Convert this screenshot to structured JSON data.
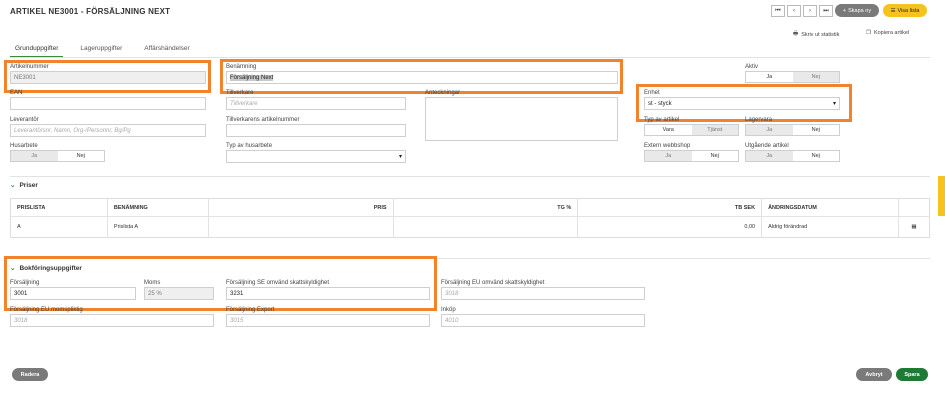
{
  "header": {
    "title": "ARTIKEL NE3001 - FÖRSÄLJNING NEXT",
    "nav": {
      "first": "⏮",
      "prev": "‹",
      "next": "›",
      "last": "⏭"
    },
    "create_new": "Skapa ny",
    "show_list": "Visa lista"
  },
  "actions": {
    "print_stats": "Skriv ut statistik",
    "copy_article": "Kopiera artikel"
  },
  "tabs": [
    "Grunduppgifter",
    "Lageruppgifter",
    "Affärshändelser"
  ],
  "form": {
    "artikelnummer": {
      "label": "Artikelnummer",
      "value": "NE3001"
    },
    "ean": {
      "label": "EAN",
      "value": ""
    },
    "leverantor": {
      "label": "Leverantör",
      "placeholder": "Leverantörsnr, Namn, Org-/Personnr, Bg/Pg"
    },
    "husarbete": {
      "label": "Husarbete",
      "yes": "Ja",
      "no": "Nej"
    },
    "benamning": {
      "label": "Benämning",
      "value": "Försäljning Next"
    },
    "tillverkare": {
      "label": "Tillverkare",
      "placeholder": "Tillverkare"
    },
    "tillverkarens_artikelnummer": {
      "label": "Tillverkarens artikelnummer",
      "value": ""
    },
    "typ_av_husarbete": {
      "label": "Typ av husarbete",
      "value": ""
    },
    "anteckningar": {
      "label": "Anteckningar",
      "value": ""
    },
    "aktiv": {
      "label": "Aktiv",
      "yes": "Ja",
      "no": "Nej"
    },
    "enhet": {
      "label": "Enhet",
      "value": "st - styck"
    },
    "typ_av_artikel": {
      "label": "Typ av artikel",
      "goods": "Vara",
      "service": "Tjänst"
    },
    "lagervara": {
      "label": "Lagervara",
      "yes": "Ja",
      "no": "Nej"
    },
    "extern_webbshop": {
      "label": "Extern webbshop",
      "yes": "Ja",
      "no": "Nej"
    },
    "utgaende_artikel": {
      "label": "Utgående artikel",
      "yes": "Ja",
      "no": "Nej"
    }
  },
  "priser": {
    "title": "Priser",
    "columns": [
      "PRISLISTA",
      "BENÄMNING",
      "PRIS",
      "TG %",
      "TB SEK",
      "ÄNDRINGSDATUM"
    ],
    "rows": [
      {
        "prislista": "A",
        "benamning": "Prislista A",
        "pris": "",
        "tg": "",
        "tb": "0,00",
        "andringsdatum": "Aldrig förändrad"
      }
    ]
  },
  "bokforing": {
    "title": "Bokföringsuppgifter",
    "forsaljning": {
      "label": "Försäljning",
      "value": "3001"
    },
    "moms": {
      "label": "Moms",
      "value": "25 %"
    },
    "forsaljning_se_omvand": {
      "label": "Försäljning SE omvänd skattskyldighet",
      "value": "3231"
    },
    "forsaljning_eu_omvand": {
      "label": "Försäljning EU omvänd skattskyldighet",
      "placeholder": "3018"
    },
    "forsaljning_eu_momspliktig": {
      "label": "Försäljning EU momspliktig",
      "placeholder": "3018"
    },
    "forsaljning_export": {
      "label": "Försäljning Export",
      "placeholder": "3015"
    },
    "inkop": {
      "label": "Inköp",
      "placeholder": "4010"
    }
  },
  "footer": {
    "delete": "Radera",
    "cancel": "Avbryt",
    "save": "Spara"
  },
  "colors": {
    "accent_green": "#1f7a35",
    "highlight": "#f0832b",
    "yellow": "#f6c31d"
  }
}
